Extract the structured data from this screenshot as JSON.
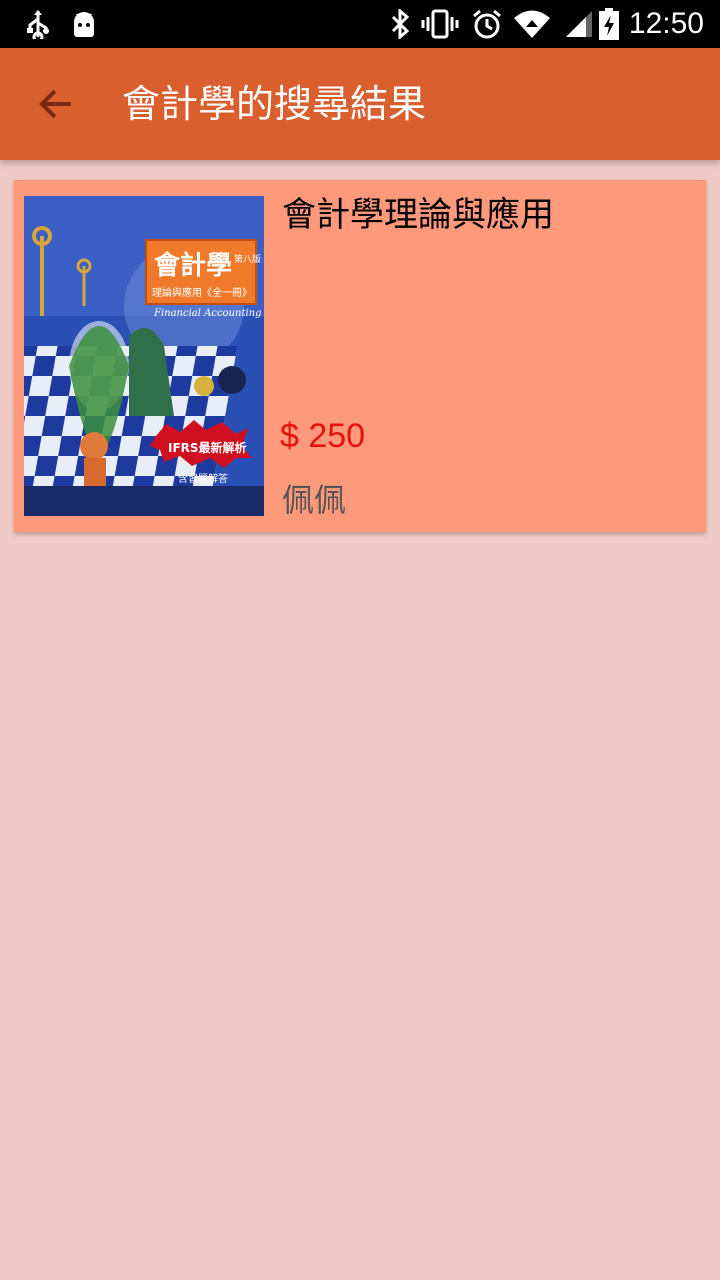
{
  "status_bar": {
    "time": "12:50",
    "icons": [
      "usb-icon",
      "android-icon",
      "bluetooth-icon",
      "vibrate-icon",
      "alarm-icon",
      "wifi-icon",
      "signal-icon",
      "battery-charging-icon"
    ]
  },
  "app_bar": {
    "title": "會計學的搜尋結果",
    "back_icon": "arrow-back-icon"
  },
  "results": [
    {
      "title": "會計學理論與應用",
      "price": "$ 250",
      "seller": "佩佩",
      "cover": {
        "main_title": "會計學",
        "edition": "第八版",
        "subtitle": "理論與應用《全一冊》",
        "english_title": "Financial Accounting",
        "badge": "IFRS最新解析",
        "note": "含習題解答"
      }
    }
  ],
  "colors": {
    "app_bar": "#d95f2f",
    "background": "#f0cac7",
    "card": "#fe9a7b",
    "price": "#e8110a"
  }
}
